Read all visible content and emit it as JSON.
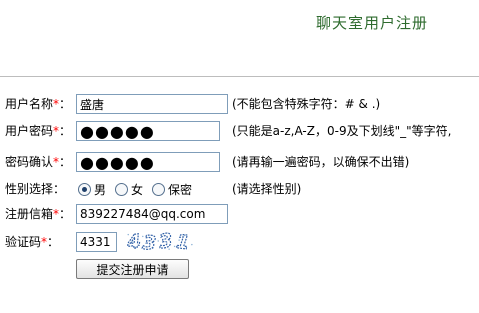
{
  "page": {
    "title": "聊天室用户注册"
  },
  "form": {
    "username": {
      "label": "用户名称",
      "required_mark": "*",
      "colon": "：",
      "value": "盛唐",
      "hint": "(不能包含特殊字符：# & .)"
    },
    "password": {
      "label": "用户密码",
      "required_mark": "*",
      "colon": "：",
      "value": "●●●●●",
      "hint": "(只能是a-z,A-Z，0-9及下划线\"_\"等字符,"
    },
    "confirm": {
      "label": "密码确认",
      "required_mark": "*",
      "colon": "：",
      "value": "●●●●●",
      "hint": "(请再输一遍密码，以确保不出错)"
    },
    "gender": {
      "label": "性别选择",
      "colon": "：",
      "options": [
        {
          "label": "男",
          "checked": true
        },
        {
          "label": "女",
          "checked": false
        },
        {
          "label": "保密",
          "checked": false
        }
      ],
      "hint": "(请选择性别)"
    },
    "email": {
      "label": "注册信箱",
      "required_mark": "*",
      "colon": "：",
      "value": "839227484@qq.com"
    },
    "captcha": {
      "label": "验证码",
      "required_mark": "*",
      "colon": "：",
      "value": "4331",
      "image_text": "4331"
    },
    "submit_label": "提交注册申请"
  }
}
